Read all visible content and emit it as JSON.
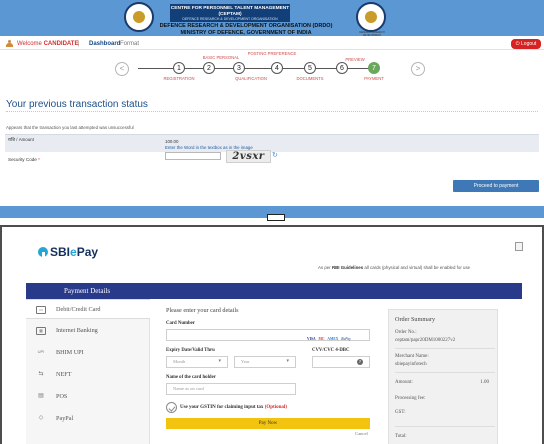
{
  "ceptam": {
    "org_name": "CENTRE FOR PERSONNEL TALENT MANAGEMENT (CEPTAM)",
    "org_sub": "DEFENCE RESEARCH & DEVELOPMENT ORGANISATION",
    "drdo_line1": "DEFENCE RESEARCH & DEVELOPMENT ORGANISATION (DRDO)",
    "drdo_line2": "MINISTRY OF DEFENCE, GOVERNMENT OF INDIA",
    "logo_caption": "DEFENCE RESEARCH DEVELOPMENT",
    "nav": {
      "welcome_prefix": "Welcome",
      "username": "CANDIDATE",
      "separator": "|",
      "dashboard": "Dashboard",
      "form": "Format",
      "logout": "Logout"
    },
    "stepper": {
      "prev": "<",
      "next": ">",
      "steps": [
        {
          "num": "1",
          "label": "REGISTRATION"
        },
        {
          "num": "2",
          "label": "BASIC PERSONAL"
        },
        {
          "num": "3",
          "label": "QUALIFICATION"
        },
        {
          "num": "4",
          "label": "POSTING PREFERENCE"
        },
        {
          "num": "5",
          "label": "DOCUMENTS"
        },
        {
          "num": "6",
          "label": "PREVIEW"
        },
        {
          "num": "7",
          "label": "PAYMENT"
        }
      ]
    },
    "page_title": "Your previous transaction status",
    "unsuccess_msg": "Appears that the transaction you last attempted was unsuccessful",
    "amount_label": "राशि / Amount",
    "amount_value": "100.00",
    "captcha_hint": "Enter the Word in the textbox as in the image",
    "security_label": "Security Code",
    "security_req": "*",
    "captcha_text": "2vsxr",
    "refresh_glyph": "↻",
    "proceed_button": "Proceed to payment",
    "colors": {
      "band": "#5b97d3",
      "title": "#1e4f8c",
      "logout": "#d62222",
      "active_step": "#6aa85e"
    }
  },
  "sbiepay": {
    "logo_prefix": "SBI",
    "logo_e": "e",
    "logo_suffix": "Pay",
    "rbi_note_prefix": "As per",
    "rbi_note_bold": "RBI Guidelines",
    "rbi_note_suffix": "all cards (physical and virtual) shall be enabled for use",
    "payment_details": "Payment Details",
    "menu": [
      {
        "label": "Debit/Credit Card",
        "icon": "card-icon",
        "glyph": "▭"
      },
      {
        "label": "Internet Banking",
        "icon": "bank-icon",
        "glyph": "▦"
      },
      {
        "label": "BHIM UPI",
        "icon": "upi-icon",
        "glyph": "UPI"
      },
      {
        "label": "NEFT",
        "icon": "transfer-icon",
        "glyph": "⇆"
      },
      {
        "label": "POS",
        "icon": "pos-icon",
        "glyph": "▤"
      },
      {
        "label": "PayPal",
        "icon": "paypal-icon",
        "glyph": "◇"
      }
    ],
    "form": {
      "heading": "Please enter your card details",
      "card_number_label": "Card Number",
      "card_brands": [
        "VISA",
        "MC",
        "AMEX",
        "RuPay"
      ],
      "expiry_label": "Expiry Date/Valid Thru",
      "month_placeholder": "Month",
      "year_placeholder": "Year",
      "cvv_label": "CVV/CVC 4-DBC",
      "holder_label": "Name of the card holder",
      "holder_placeholder": "Name as on card",
      "gstin_text": "Use your GSTIN for claiming input tax",
      "gstin_optional": "(Optional)",
      "pay_now": "Pay Now",
      "cancel": "Cancel"
    },
    "summary": {
      "title": "Order Summary",
      "order_no_label": "Order No.:",
      "order_no_value": "ceptam/papr20DM1000227v2",
      "merchant_label": "Merchant Name:",
      "merchant_value": "sbiepayinfotech",
      "amount_label": "Amount:",
      "amount_value": "1.00",
      "processing_label": "Processing fee:",
      "gst_label": "GST:",
      "total_label": "Total:"
    },
    "colors": {
      "bar": "#2a3a8a",
      "pay_now": "#f2c40f",
      "logo_blue": "#12305d",
      "logo_cyan": "#22a6d6"
    }
  }
}
